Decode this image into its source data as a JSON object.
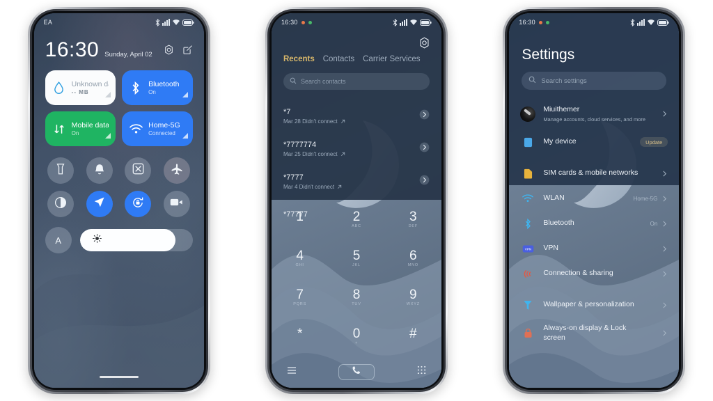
{
  "background_color": "#ffffff",
  "phones": [
    {
      "id": "phone-control-center",
      "status_bar": {
        "carrier": "EA",
        "icons": [
          "bluetooth-icon",
          "signal-icon",
          "wifi-icon",
          "battery-icon"
        ]
      },
      "control_center": {
        "clock": "16:30",
        "date": "Sunday, April 02",
        "actions": [
          "settings-gear-icon",
          "edit-icon"
        ],
        "tiles": [
          {
            "title": "Unknown data plan",
            "sub": "-- MB",
            "style": "white",
            "icon": "data-drop-icon"
          },
          {
            "title": "Bluetooth",
            "sub": "On",
            "style": "blue",
            "icon": "bluetooth-icon"
          },
          {
            "title": "Mobile data",
            "sub": "On",
            "style": "green",
            "icon": "mobile-data-icon"
          },
          {
            "title": "Home-5G",
            "sub": "Connected",
            "style": "blue",
            "icon": "wifi-icon"
          }
        ],
        "toggles_row1": [
          {
            "name": "flashlight",
            "icon": "flashlight-icon",
            "active": false
          },
          {
            "name": "do-not-disturb",
            "icon": "bell-icon",
            "active": false
          },
          {
            "name": "screenshot",
            "icon": "screenshot-icon",
            "active": false
          },
          {
            "name": "airplane-mode",
            "icon": "airplane-icon",
            "active": false
          }
        ],
        "toggles_row2": [
          {
            "name": "dark-mode",
            "icon": "contrast-icon",
            "active": false
          },
          {
            "name": "location",
            "icon": "location-arrow-icon",
            "active": true
          },
          {
            "name": "rotation-lock",
            "icon": "rotation-lock-icon",
            "active": true
          },
          {
            "name": "screen-recorder",
            "icon": "video-camera-icon",
            "active": false
          }
        ],
        "auto_brightness_label": "A",
        "brightness_icon": "brightness-sun-icon",
        "brightness_percent": 85
      }
    },
    {
      "id": "phone-dialer",
      "status_bar": {
        "time": "16:30",
        "dots": [
          "orange",
          "green"
        ],
        "icons": [
          "bluetooth-icon",
          "signal-icon",
          "wifi-icon",
          "battery-icon"
        ]
      },
      "dialer": {
        "settings_icon": "settings-gear-icon",
        "tabs": [
          {
            "label": "Recents",
            "active": true
          },
          {
            "label": "Contacts",
            "active": false
          },
          {
            "label": "Carrier Services",
            "active": false
          }
        ],
        "search_placeholder": "Search contacts",
        "search_icon": "search-icon",
        "calls": [
          {
            "number": "*7",
            "meta": "Mar 28 Didn't connect",
            "arrow": "outgoing-arrow-icon"
          },
          {
            "number": "*7777774",
            "meta": "Mar 25 Didn't connect",
            "arrow": "outgoing-arrow-icon"
          },
          {
            "number": "*7777",
            "meta": "Mar 4 Didn't connect",
            "arrow": "outgoing-arrow-icon"
          },
          {
            "number": "*77777",
            "meta": "",
            "arrow": ""
          }
        ],
        "keypad": [
          {
            "digit": "1",
            "letters": ""
          },
          {
            "digit": "2",
            "letters": "ABC"
          },
          {
            "digit": "3",
            "letters": "DEF"
          },
          {
            "digit": "4",
            "letters": "GHI"
          },
          {
            "digit": "5",
            "letters": "JKL"
          },
          {
            "digit": "6",
            "letters": "MNO"
          },
          {
            "digit": "7",
            "letters": "PQRS"
          },
          {
            "digit": "8",
            "letters": "TUV"
          },
          {
            "digit": "9",
            "letters": "WXYZ"
          },
          {
            "digit": "*",
            "letters": ""
          },
          {
            "digit": "0",
            "letters": "+"
          },
          {
            "digit": "#",
            "letters": ""
          }
        ],
        "bottom_bar": {
          "menu_icon": "hamburger-menu-icon",
          "call_icon": "phone-handset-icon",
          "keypad_icon": "keypad-grid-icon"
        }
      }
    },
    {
      "id": "phone-settings",
      "status_bar": {
        "time": "16:30",
        "dots": [
          "orange",
          "green"
        ],
        "icons": [
          "bluetooth-icon",
          "signal-icon",
          "wifi-icon",
          "battery-icon"
        ]
      },
      "settings": {
        "title": "Settings",
        "search_placeholder": "Search settings",
        "search_icon": "search-icon",
        "items": [
          {
            "name": "Miuithemer",
            "desc": "Manage accounts, cloud services, and more",
            "icon": "account-avatar",
            "value": "",
            "badge": "",
            "chevron": true
          },
          {
            "name": "My device",
            "desc": "",
            "icon": "device-icon",
            "icon_color": "#4aa8e8",
            "value": "",
            "badge": "Update",
            "chevron": false
          },
          {
            "name": "SIM cards & mobile networks",
            "desc": "",
            "icon": "sim-card-icon",
            "icon_color": "#e8b33c",
            "value": "",
            "badge": "",
            "chevron": true
          },
          {
            "name": "WLAN",
            "desc": "",
            "icon": "wifi-icon",
            "icon_color": "#3fb5f0",
            "value": "Home-5G",
            "badge": "",
            "chevron": true
          },
          {
            "name": "Bluetooth",
            "desc": "",
            "icon": "bluetooth-icon",
            "icon_color": "#3fb5f0",
            "value": "On",
            "badge": "",
            "chevron": true
          },
          {
            "name": "VPN",
            "desc": "",
            "icon": "vpn-icon",
            "icon_color": "#4a5fe0",
            "value": "",
            "badge": "",
            "chevron": true
          },
          {
            "name": "Connection & sharing",
            "desc": "",
            "icon": "connection-sharing-icon",
            "icon_color": "#e05a45",
            "value": "",
            "badge": "",
            "chevron": true
          },
          {
            "name": "Wallpaper & personalization",
            "desc": "",
            "icon": "wallpaper-icon",
            "icon_color": "#3fb5f0",
            "value": "",
            "badge": "",
            "chevron": true
          },
          {
            "name": "Always-on display & Lock screen",
            "desc": "",
            "icon": "lock-icon",
            "icon_color": "#e07055",
            "value": "",
            "badge": "",
            "chevron": true
          }
        ]
      }
    }
  ]
}
